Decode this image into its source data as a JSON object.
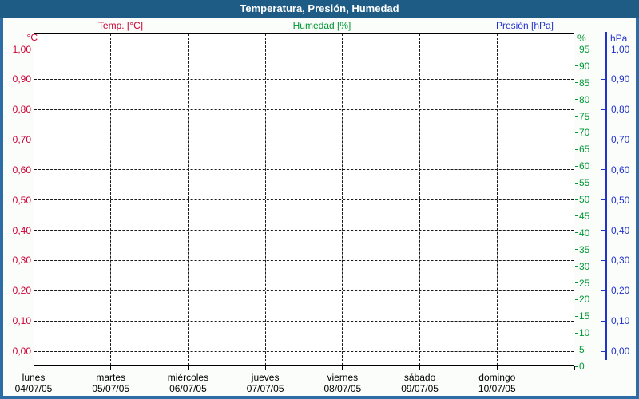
{
  "window": {
    "title": "Temperatura, Presión, Humedad",
    "titlebar_color": "#1E5C86",
    "frame_color": "#2D6DA5"
  },
  "legend": {
    "items": [
      {
        "label": "Temp. [°C]",
        "color": "#CC0033"
      },
      {
        "label": "Humedad [%]",
        "color": "#009933"
      },
      {
        "label": "Presión [hPa]",
        "color": "#2233CC"
      }
    ]
  },
  "chart_data": {
    "type": "line",
    "title": "Temperatura, Presión, Humedad",
    "grid": true,
    "legend_position": "top",
    "note": "empty plot: axes and dashed grid only, no data points drawn",
    "x_axis": {
      "days": [
        {
          "name": "lunes",
          "date": "04/07/05"
        },
        {
          "name": "martes",
          "date": "05/07/05"
        },
        {
          "name": "miércoles",
          "date": "06/07/05"
        },
        {
          "name": "jueves",
          "date": "07/07/05"
        },
        {
          "name": "viernes",
          "date": "08/07/05"
        },
        {
          "name": "sábado",
          "date": "09/07/05"
        },
        {
          "name": "domingo",
          "date": "10/07/05"
        }
      ]
    },
    "y_axes": [
      {
        "id": "temperature",
        "unit": "°C",
        "side": "left",
        "color": "#CC0033",
        "tick_labels": [
          "1,00",
          "0,90",
          "0,80",
          "0,70",
          "0,60",
          "0,50",
          "0,40",
          "0,30",
          "0,20",
          "0,10",
          "0,00"
        ],
        "tick_values": [
          1.0,
          0.9,
          0.8,
          0.7,
          0.6,
          0.5,
          0.4,
          0.3,
          0.2,
          0.1,
          0.0
        ]
      },
      {
        "id": "humidity",
        "unit": "%",
        "side": "right",
        "color": "#009933",
        "range": [
          0,
          100
        ],
        "tick_labels": [
          "95",
          "90",
          "85",
          "80",
          "75",
          "70",
          "65",
          "60",
          "55",
          "50",
          "45",
          "40",
          "35",
          "30",
          "25",
          "20",
          "15",
          "10",
          "5",
          "0"
        ],
        "tick_values": [
          95,
          90,
          85,
          80,
          75,
          70,
          65,
          60,
          55,
          50,
          45,
          40,
          35,
          30,
          25,
          20,
          15,
          10,
          5,
          0
        ]
      },
      {
        "id": "pressure",
        "unit": "hPa",
        "side": "right_outer",
        "color": "#2233CC",
        "tick_labels": [
          "1,00",
          "0,90",
          "0,80",
          "0,70",
          "0,60",
          "0,50",
          "0,40",
          "0,30",
          "0,20",
          "0,10",
          "0,00"
        ],
        "tick_values": [
          1.0,
          0.9,
          0.8,
          0.7,
          0.6,
          0.5,
          0.4,
          0.3,
          0.2,
          0.1,
          0.0
        ]
      }
    ],
    "series": [
      {
        "name": "Temp. [°C]",
        "color": "#CC0033",
        "y_axis": "temperature",
        "points": []
      },
      {
        "name": "Humedad [%]",
        "color": "#009933",
        "y_axis": "humidity",
        "points": []
      },
      {
        "name": "Presión [hPa]",
        "color": "#2233CC",
        "y_axis": "pressure",
        "points": []
      }
    ]
  }
}
